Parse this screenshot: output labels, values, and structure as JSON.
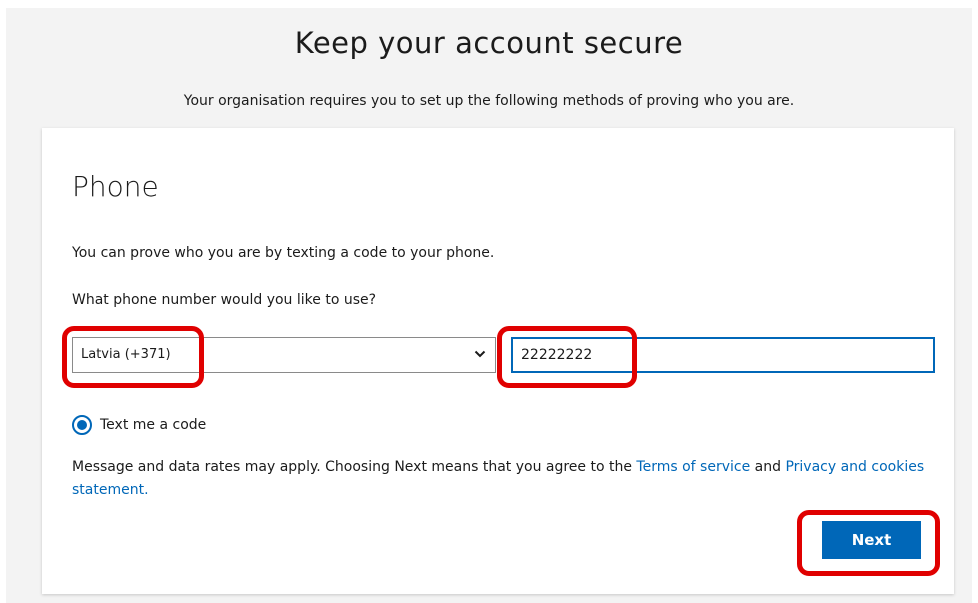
{
  "header": {
    "title": "Keep your account secure",
    "subtitle": "Your organisation requires you to set up the following methods of proving who you are."
  },
  "card": {
    "heading": "Phone",
    "description": "You can prove who you are by texting a code to your phone.",
    "question": "What phone number would you like to use?",
    "country_select": {
      "value": "Latvia (+371)"
    },
    "phone_input": {
      "value": "22222222"
    },
    "radio": {
      "label": "Text me a code",
      "checked": true
    },
    "disclaimer": {
      "text": "Message and data rates may apply. Choosing Next means that you agree to the ",
      "terms_link": "Terms of service",
      "and_text": " and ",
      "privacy_link": "Privacy and cookies statement."
    },
    "next_label": "Next"
  },
  "colors": {
    "accent": "#0067b8",
    "highlight": "#e00000",
    "background": "#f3f3f3"
  }
}
